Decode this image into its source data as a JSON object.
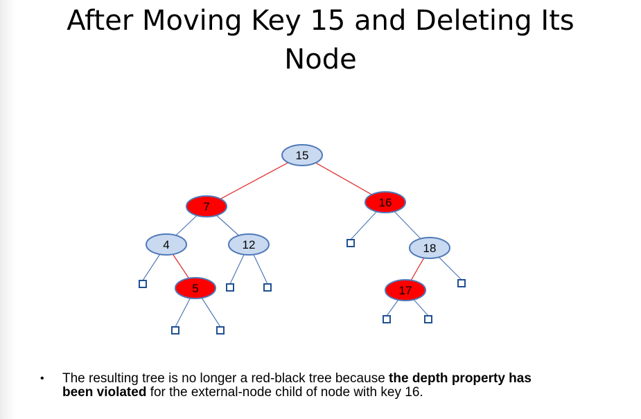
{
  "title": {
    "line1": "After Moving Key 15 and Deleting Its",
    "line2": "Node"
  },
  "colors": {
    "black_node_fill": "#c9d9f0",
    "red_node_fill": "#ff0000",
    "node_border": "#4f79b8",
    "black_edge": "#4f79b8",
    "red_edge": "#e02020",
    "leaf_border": "#1f4f8f"
  },
  "tree": {
    "nodes": [
      {
        "key": "15",
        "color": "black"
      },
      {
        "key": "7",
        "color": "red"
      },
      {
        "key": "16",
        "color": "red"
      },
      {
        "key": "4",
        "color": "black"
      },
      {
        "key": "12",
        "color": "black"
      },
      {
        "key": "18",
        "color": "black"
      },
      {
        "key": "5",
        "color": "red"
      },
      {
        "key": "17",
        "color": "red"
      }
    ]
  },
  "caption": {
    "part1": "The resulting tree is no longer a red-black tree because ",
    "bold1": "the depth property has",
    "bold2": "been violated",
    "part2": " for the external-node child of node with key 16."
  }
}
